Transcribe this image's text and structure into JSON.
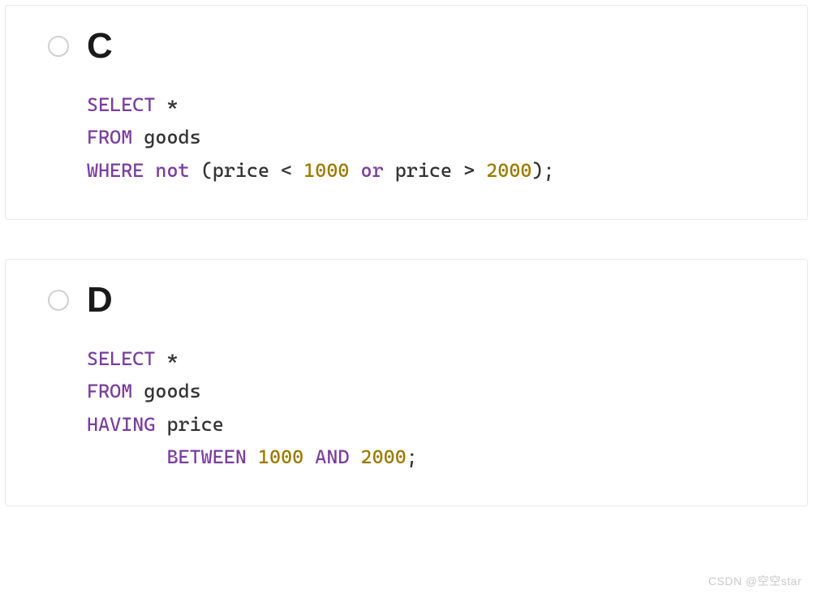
{
  "options": [
    {
      "letter": "C",
      "code": {
        "line1_kw": "SELECT",
        "line1_rest": " *",
        "line2_kw": "FROM",
        "line2_rest": " goods",
        "line3_kw1": "WHERE",
        "line3_kw2": "not",
        "line3_p1": " (price ",
        "line3_op1": "<",
        "line3_sp1": " ",
        "line3_n1": "1000",
        "line3_sp2": " ",
        "line3_kw3": "or",
        "line3_p2": " price ",
        "line3_op2": ">",
        "line3_sp3": " ",
        "line3_n2": "2000",
        "line3_end": ");"
      }
    },
    {
      "letter": "D",
      "code": {
        "line1_kw": "SELECT",
        "line1_rest": " *",
        "line2_kw": "FROM",
        "line2_rest": " goods",
        "line3_kw": "HAVING",
        "line3_rest": " price",
        "line4_indent": "       ",
        "line4_kw1": "BETWEEN",
        "line4_sp1": " ",
        "line4_n1": "1000",
        "line4_sp2": " ",
        "line4_kw2": "AND",
        "line4_sp3": " ",
        "line4_n2": "2000",
        "line4_end": ";"
      }
    }
  ],
  "watermark": "CSDN @空空star"
}
